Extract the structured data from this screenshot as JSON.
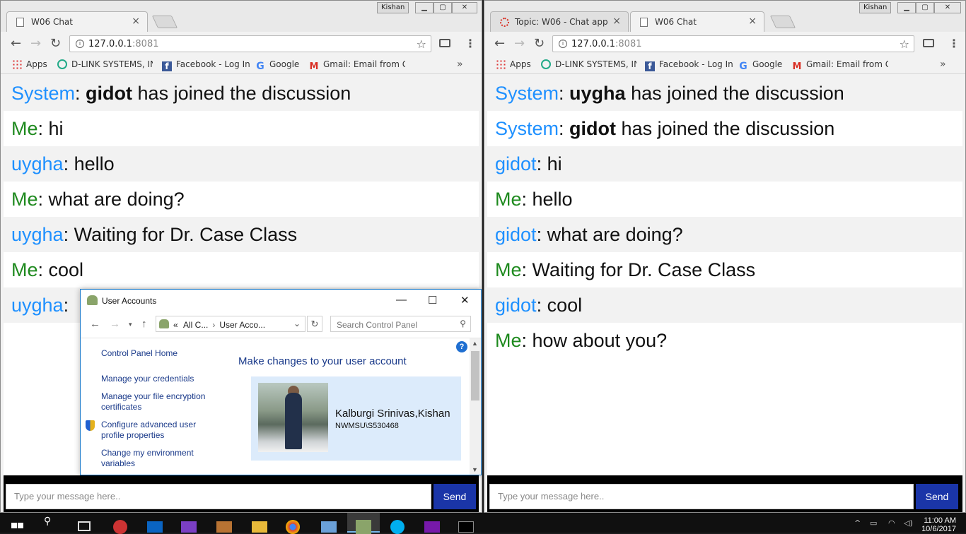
{
  "windows": [
    {
      "user_badge": "Kishan",
      "tabs": [
        {
          "label": "W06 Chat",
          "active": true
        }
      ],
      "url": {
        "host": "127.0.0.1",
        "port": ":8081"
      },
      "bookmarks": [
        "Apps",
        "D-LINK SYSTEMS, INC",
        "Facebook - Log In",
        "Google",
        "Gmail: Email from Go"
      ],
      "messages": [
        {
          "sender": "System",
          "kind": "system",
          "user": "gidot",
          "text": " has joined the discussion"
        },
        {
          "sender": "Me",
          "kind": "me",
          "text": ": hi"
        },
        {
          "sender": "uygha",
          "kind": "peer",
          "text": ": hello"
        },
        {
          "sender": "Me",
          "kind": "me",
          "text": ": what are doing?"
        },
        {
          "sender": "uygha",
          "kind": "peer",
          "text": ": Waiting for Dr. Case Class"
        },
        {
          "sender": "Me",
          "kind": "me",
          "text": ": cool"
        },
        {
          "sender": "uygha",
          "kind": "peer",
          "text": ":"
        }
      ],
      "input_placeholder": "Type your message here..",
      "send_label": "Send"
    },
    {
      "user_badge": "Kishan",
      "tabs": [
        {
          "label": "Topic: W06 - Chat app",
          "active": false
        },
        {
          "label": "W06 Chat",
          "active": true
        }
      ],
      "url": {
        "host": "127.0.0.1",
        "port": ":8081"
      },
      "bookmarks": [
        "Apps",
        "D-LINK SYSTEMS, INC",
        "Facebook - Log In",
        "Google",
        "Gmail: Email from Go"
      ],
      "messages": [
        {
          "sender": "System",
          "kind": "system",
          "user": "uygha",
          "text": " has joined the discussion"
        },
        {
          "sender": "System",
          "kind": "system",
          "user": "gidot",
          "text": " has joined the discussion"
        },
        {
          "sender": "gidot",
          "kind": "peer",
          "text": ": hi"
        },
        {
          "sender": "Me",
          "kind": "me",
          "text": ": hello"
        },
        {
          "sender": "gidot",
          "kind": "peer",
          "text": ": what are doing?"
        },
        {
          "sender": "Me",
          "kind": "me",
          "text": ": Waiting for Dr. Case Class"
        },
        {
          "sender": "gidot",
          "kind": "peer",
          "text": ": cool"
        },
        {
          "sender": "Me",
          "kind": "me",
          "text": ": how about you?"
        }
      ],
      "input_placeholder": "Type your message here..",
      "send_label": "Send"
    }
  ],
  "dialog": {
    "title": "User Accounts",
    "breadcrumb_prefix": "«",
    "breadcrumb": [
      "All C...",
      "User Acco..."
    ],
    "search_placeholder": "Search Control Panel",
    "links": {
      "home": "Control Panel Home",
      "credentials": "Manage your credentials",
      "encryption": "Manage your file encryption certificates",
      "advanced": "Configure advanced user profile properties",
      "environment": "Change my environment variables"
    },
    "heading": "Make changes to your user account",
    "account_name": "Kalburgi Srinivas,Kishan",
    "account_domain": "NWMSU\\S530468"
  },
  "taskbar": {
    "time": "11:00 AM",
    "date": "10/6/2017"
  },
  "colors": {
    "system_sender": "#1e90ff",
    "me_sender": "#1e8a1e",
    "send_button": "#1a35a8"
  }
}
